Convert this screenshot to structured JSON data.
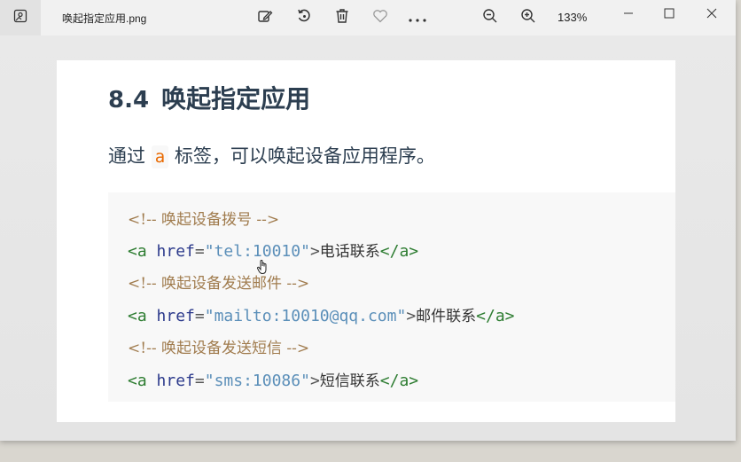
{
  "titlebar": {
    "filename": "唤起指定应用.png",
    "zoom": "133%",
    "icons": [
      "gallery-icon",
      "edit-image-icon",
      "rotate-icon",
      "delete-icon",
      "favorite-icon",
      "more-icon",
      "zoom-out-icon",
      "zoom-in-icon",
      "minimize-icon",
      "maximize-icon",
      "close-icon"
    ]
  },
  "document": {
    "heading_number": "8.4",
    "heading_text": "唤起指定应用",
    "para_before": "通过",
    "para_code": "a",
    "para_after": "标签，可以唤起设备应用程序。",
    "code": {
      "comment1": "<!-- 唤起设备拨号 -->",
      "line1_tag_open": "<a",
      "line1_attr": "href",
      "line1_eq": "=",
      "line1_value": "\"tel:10010\"",
      "line1_gt": ">",
      "line1_text": "电话联系",
      "line1_close": "</a>",
      "comment2": "<!-- 唤起设备发送邮件 -->",
      "line2_tag_open": "<a",
      "line2_attr": "href",
      "line2_eq": "=",
      "line2_value": "\"mailto:10010@qq.com\"",
      "line2_gt": ">",
      "line2_text": "邮件联系",
      "line2_close": "</a>",
      "comment3": "<!-- 唤起设备发送短信 -->",
      "line3_tag_open": "<a",
      "line3_attr": "href",
      "line3_eq": "=",
      "line3_value": "\"sms:10086\"",
      "line3_gt": ">",
      "line3_text": "短信联系",
      "line3_close": "</a>"
    }
  },
  "colors": {
    "heading": "#2c3e50",
    "inline_code": "#e96900",
    "comment": "#a07b4d",
    "tag": "#2e7d32",
    "attr": "#2c3a8c",
    "string": "#5b8fb9"
  }
}
